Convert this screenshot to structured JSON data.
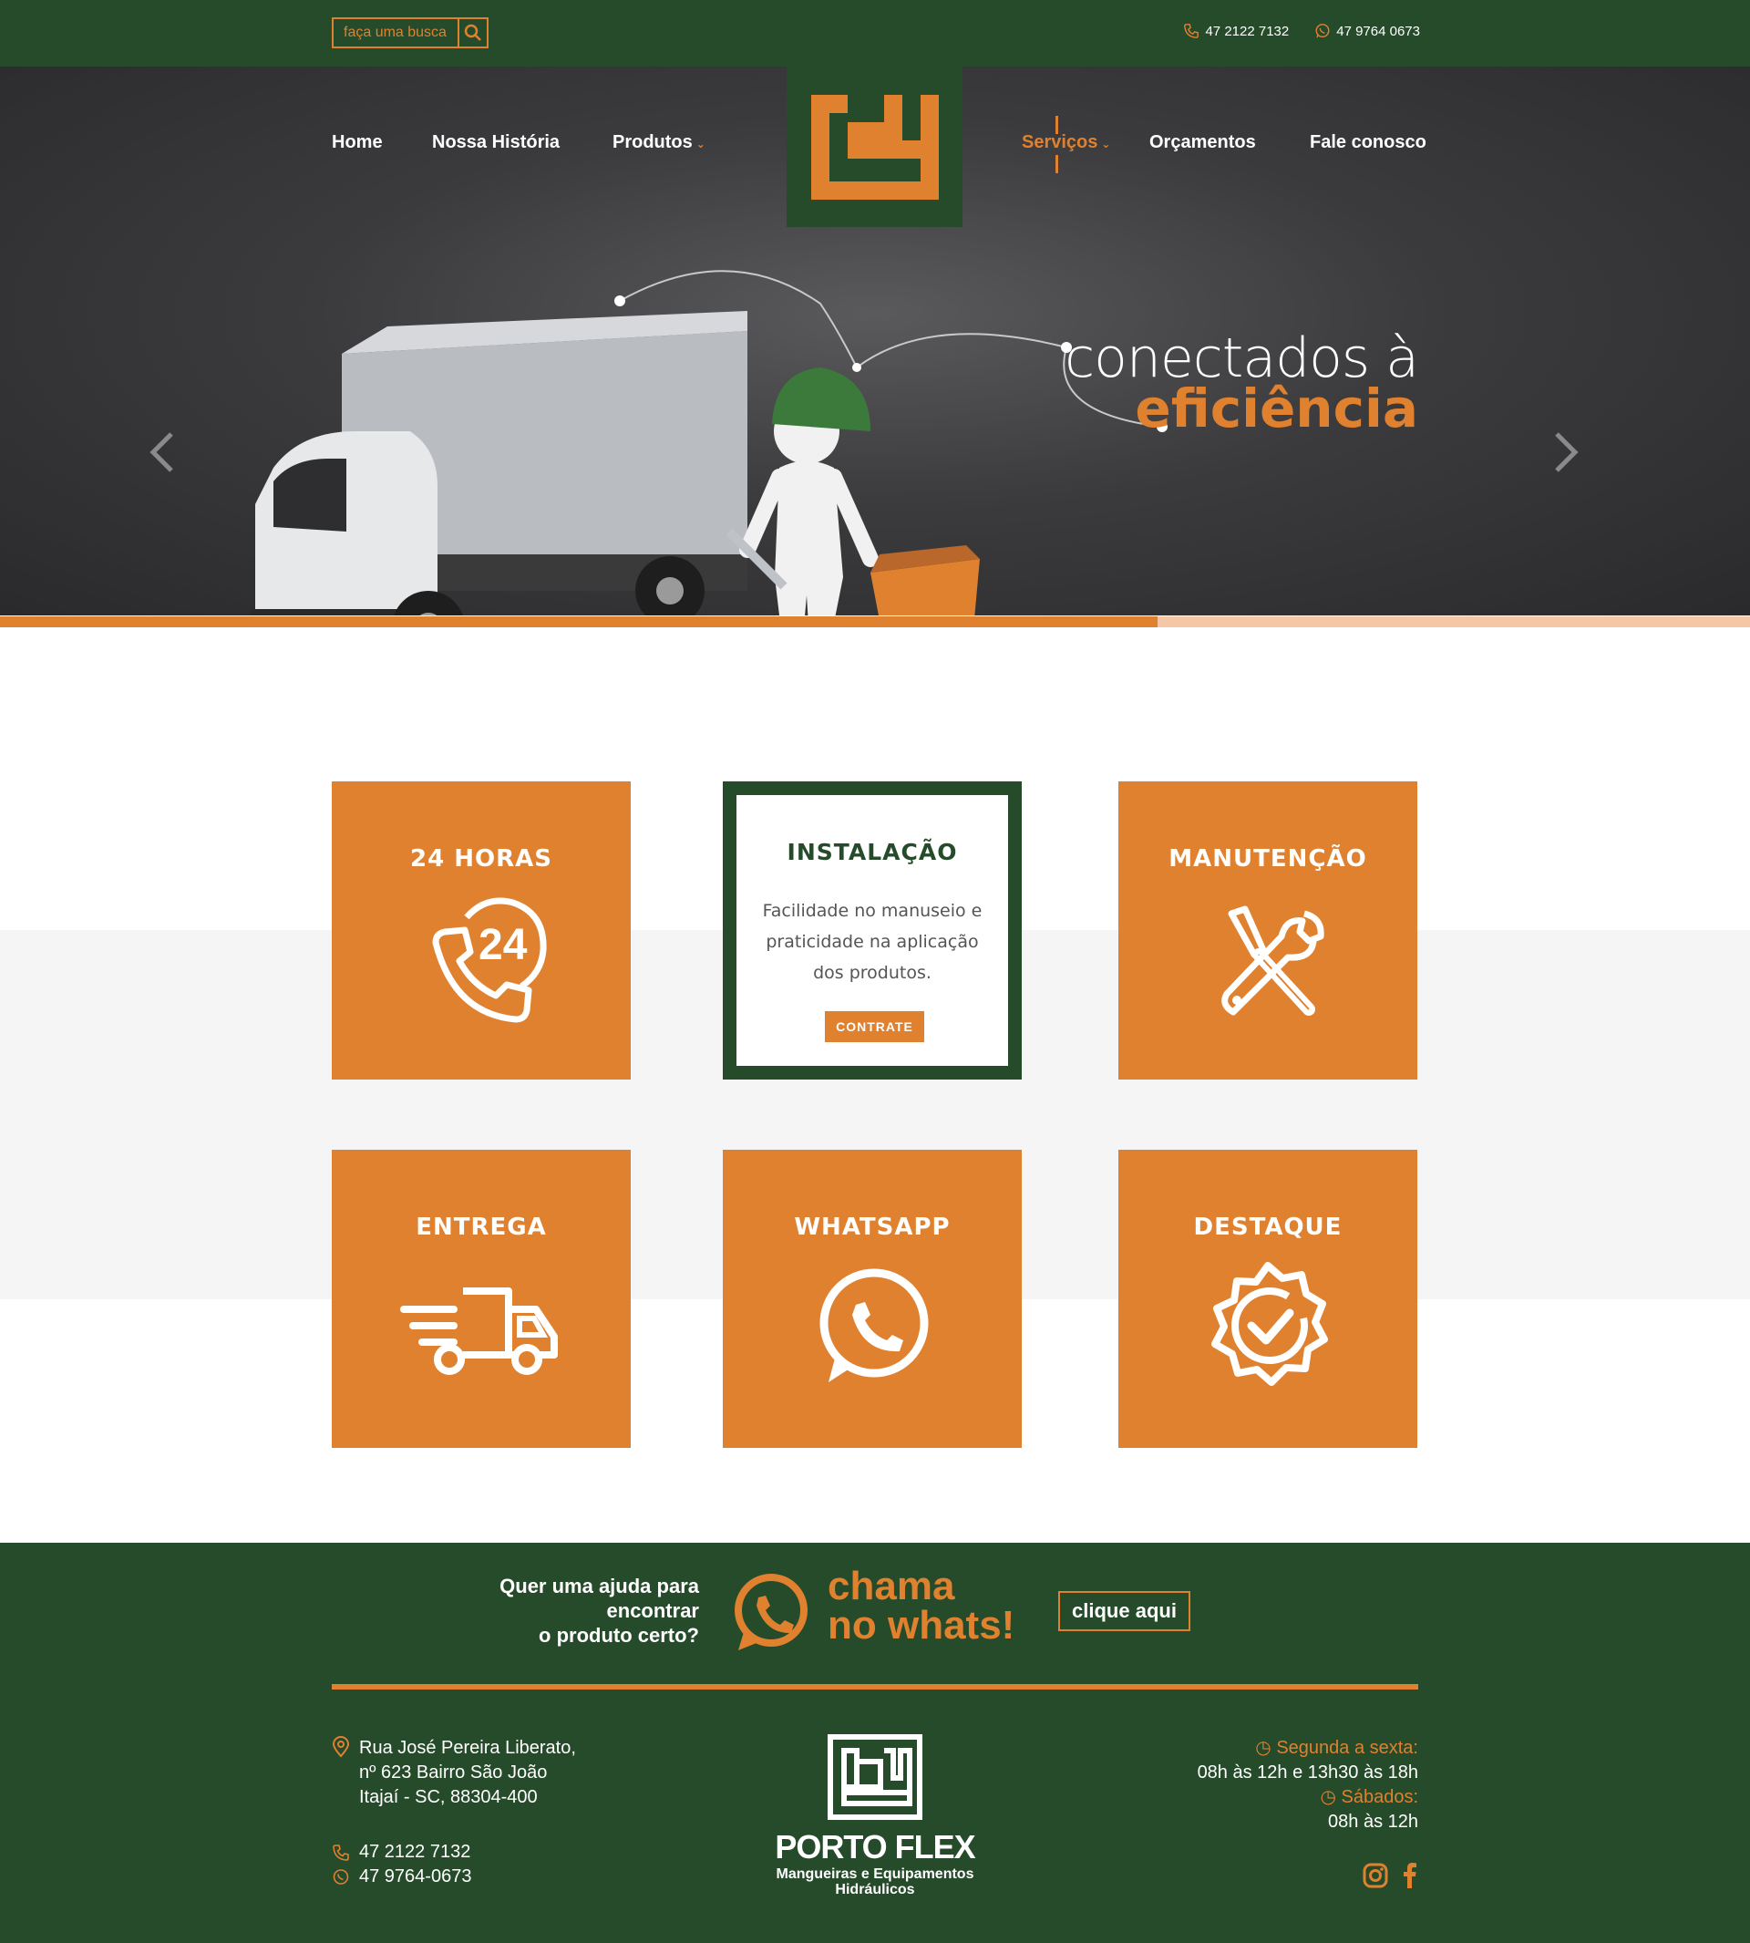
{
  "header": {
    "search_placeholder": "faça uma busca",
    "phone": "47 2122 7132",
    "whatsapp": "47 9764 0673"
  },
  "nav": {
    "home": "Home",
    "historia": "Nossa História",
    "produtos": "Produtos",
    "servicos": "Serviços",
    "orcamentos": "Orçamentos",
    "fale": "Fale conosco"
  },
  "hero": {
    "line1": "conectados à",
    "line2": "eficiência"
  },
  "services": [
    {
      "title": "24 HORAS",
      "icon": "phone-24-icon"
    },
    {
      "title": "INSTALAÇÃO",
      "text": "Facilidade no manuseio e praticidade na aplicação dos produtos.",
      "button": "CONTRATE"
    },
    {
      "title": "MANUTENÇÃO",
      "icon": "tools-icon"
    },
    {
      "title": "ENTREGA",
      "icon": "delivery-truck-icon"
    },
    {
      "title": "WHATSAPP",
      "icon": "whatsapp-icon"
    },
    {
      "title": "DESTAQUE",
      "icon": "badge-check-icon"
    }
  ],
  "cta": {
    "help_line1": "Quer uma ajuda para",
    "help_line2": "encontrar",
    "help_line3": "o produto certo?",
    "chama_line1": "chama",
    "chama_line2": "no whats!",
    "button": "clique aqui"
  },
  "footer": {
    "address_line1": "Rua José Pereira Liberato,",
    "address_line2": "nº 623 Bairro São João",
    "address_line3": "Itajaí - SC, 88304-400",
    "phone": "47 2122 7132",
    "whatsapp": "47 9764-0673",
    "brand": "PORTO FLEX",
    "brand_sub1": "Mangueiras e Equipamentos",
    "brand_sub2": "Hidráulicos",
    "hours_label1": "Segunda a sexta:",
    "hours_value1": "08h às 12h e 13h30 às 18h",
    "hours_label2": "Sábados:",
    "hours_value2": "08h às 12h"
  },
  "colors": {
    "green": "#264b2b",
    "orange": "#df812f",
    "light_orange": "#f6c7a4",
    "dark_gray": "#3b3b3d"
  }
}
